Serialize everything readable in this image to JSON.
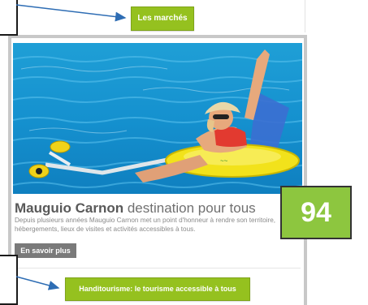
{
  "top_card": {
    "button_label": "Les marchés"
  },
  "card": {
    "title_bold": "Mauguio Carnon",
    "title_rest": " destination pour tous",
    "description": "Depuis plusieurs années Mauguio Carnon met un point d'honneur à rendre son territoire, hébergements, lieux de visites et activités accessibles à tous.",
    "more_button": "En savoir plus",
    "link_button": "Handitourisme: le tourisme accessible à tous"
  },
  "badge": {
    "number": "94"
  },
  "colors": {
    "accent_green": "#95c11f",
    "badge_green": "#8dc63f",
    "arrow_blue": "#2e6db4"
  }
}
